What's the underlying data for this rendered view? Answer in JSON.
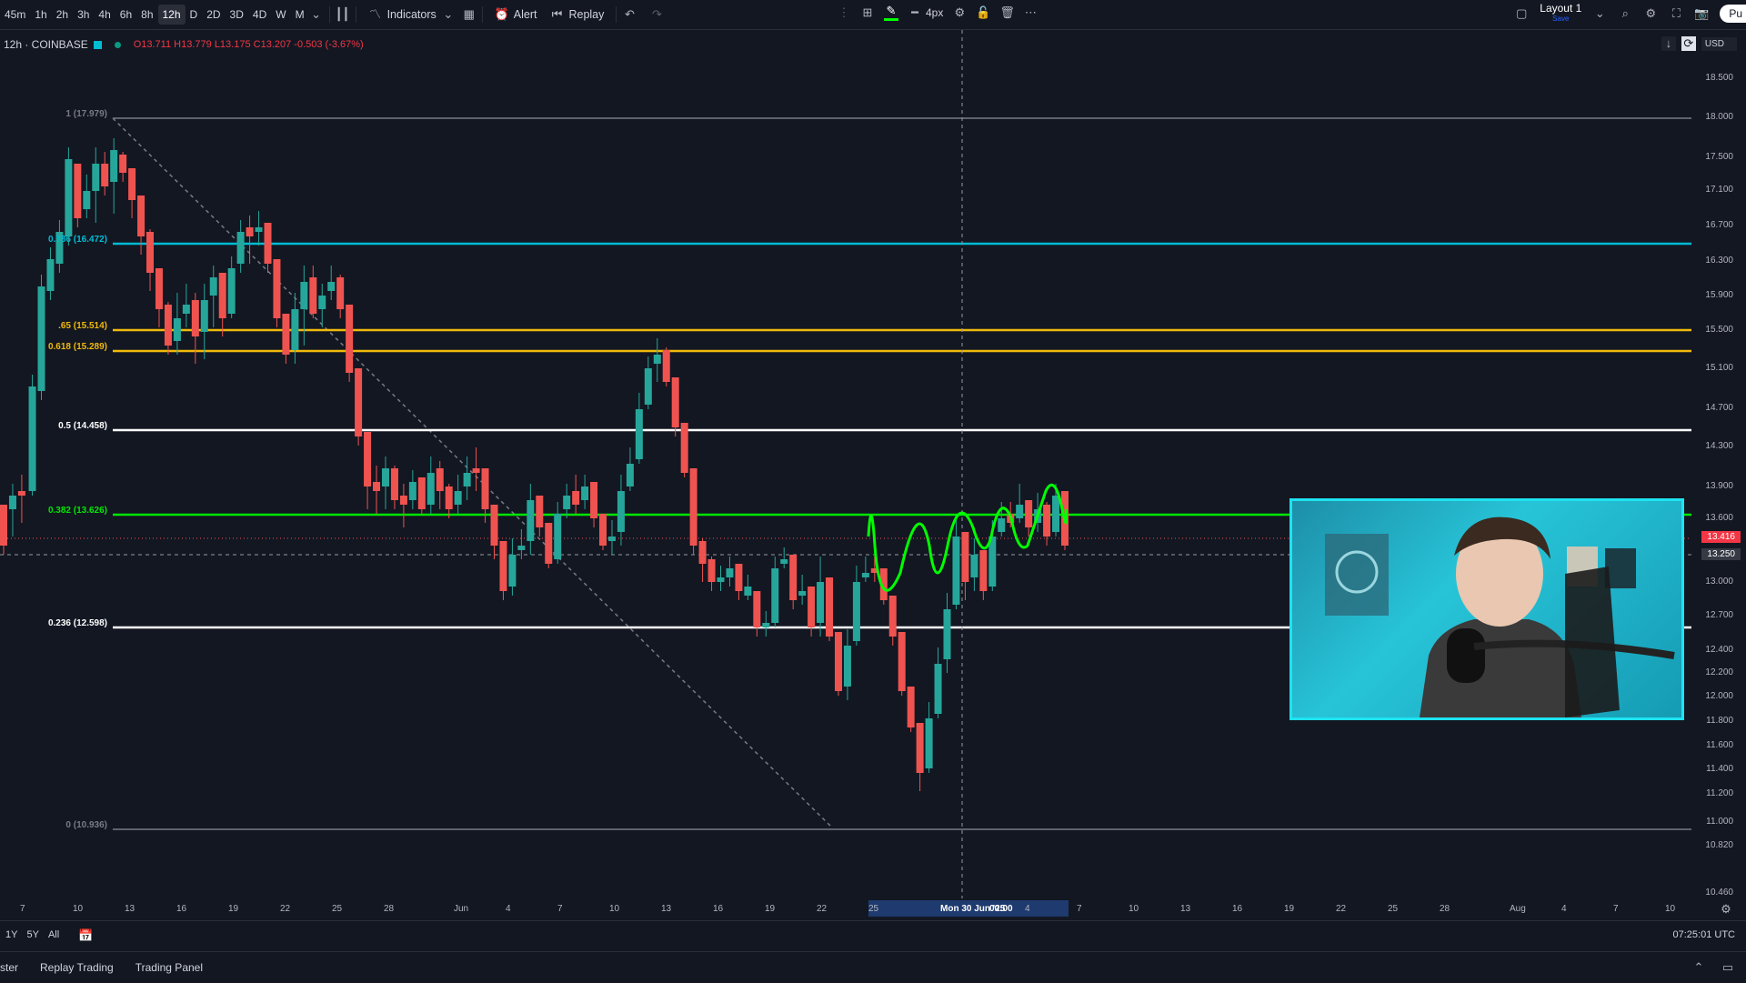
{
  "toolbar": {
    "timeframes": [
      "45m",
      "1h",
      "2h",
      "3h",
      "4h",
      "6h",
      "8h",
      "12h",
      "D",
      "2D",
      "3D",
      "4D",
      "W",
      "M"
    ],
    "active_timeframe": "12h",
    "indicators_label": "Indicators",
    "alert_label": "Alert",
    "replay_label": "Replay",
    "stroke_width": "4px",
    "layout_label": "Layout 1",
    "layout_sub": "Save",
    "publish_label": "Pu"
  },
  "legend": {
    "symbol": "12h · COINBASE",
    "open": "O13.711",
    "high": "H13.779",
    "low": "L13.175",
    "close": "C13.207",
    "change": "-0.503 (-3.67%)"
  },
  "fib_levels": [
    {
      "label": "1 (17.979)",
      "value": 17.979,
      "color": "#787b86"
    },
    {
      "label": "0.786 (16.472)",
      "value": 16.472,
      "color": "#00bcd4"
    },
    {
      "label": ".65 (15.514)",
      "value": 15.514,
      "color": "#f0b90b"
    },
    {
      "label": "0.618 (15.289)",
      "value": 15.289,
      "color": "#f0b90b"
    },
    {
      "label": "0.5 (14.458)",
      "value": 14.458,
      "color": "#ffffff"
    },
    {
      "label": "0.382 (13.626)",
      "value": 13.626,
      "color": "#00e600"
    },
    {
      "label": "0.236 (12.598)",
      "value": 12.598,
      "color": "#ffffff"
    },
    {
      "label": "0 (10.936)",
      "value": 10.936,
      "color": "#787b86"
    }
  ],
  "price_axis": {
    "currency": "USD",
    "ticks": [
      "18.500",
      "18.000",
      "17.500",
      "17.100",
      "16.700",
      "16.300",
      "15.900",
      "15.500",
      "15.100",
      "14.700",
      "14.300",
      "13.900",
      "13.600",
      "13.000",
      "12.700",
      "12.400",
      "12.200",
      "12.000",
      "11.800",
      "11.600",
      "11.400",
      "11.200",
      "11.000",
      "10.820",
      "10.460"
    ],
    "last_price": "13.416",
    "crosshair_price": "13.250"
  },
  "time_axis": {
    "ticks": [
      "7",
      "10",
      "13",
      "16",
      "19",
      "22",
      "25",
      "28",
      "Jun",
      "4",
      "7",
      "10",
      "13",
      "16",
      "19",
      "22",
      "25",
      "Mon 30 Jun '25",
      "00:00",
      "4",
      "7",
      "10",
      "13",
      "16",
      "19",
      "22",
      "25",
      "28",
      "Aug",
      "4",
      "7",
      "10"
    ]
  },
  "range_bar": {
    "ranges": [
      "1Y",
      "5Y",
      "All"
    ],
    "clock": "07:25:01 UTC"
  },
  "footer": {
    "tabs": [
      "ster",
      "Replay Trading",
      "Trading Panel"
    ]
  },
  "colors": {
    "up": "#26a69a",
    "down": "#ef5350",
    "background": "#131722",
    "drawing": "#00ff00",
    "webcam_border": "#1ee3f0"
  }
}
